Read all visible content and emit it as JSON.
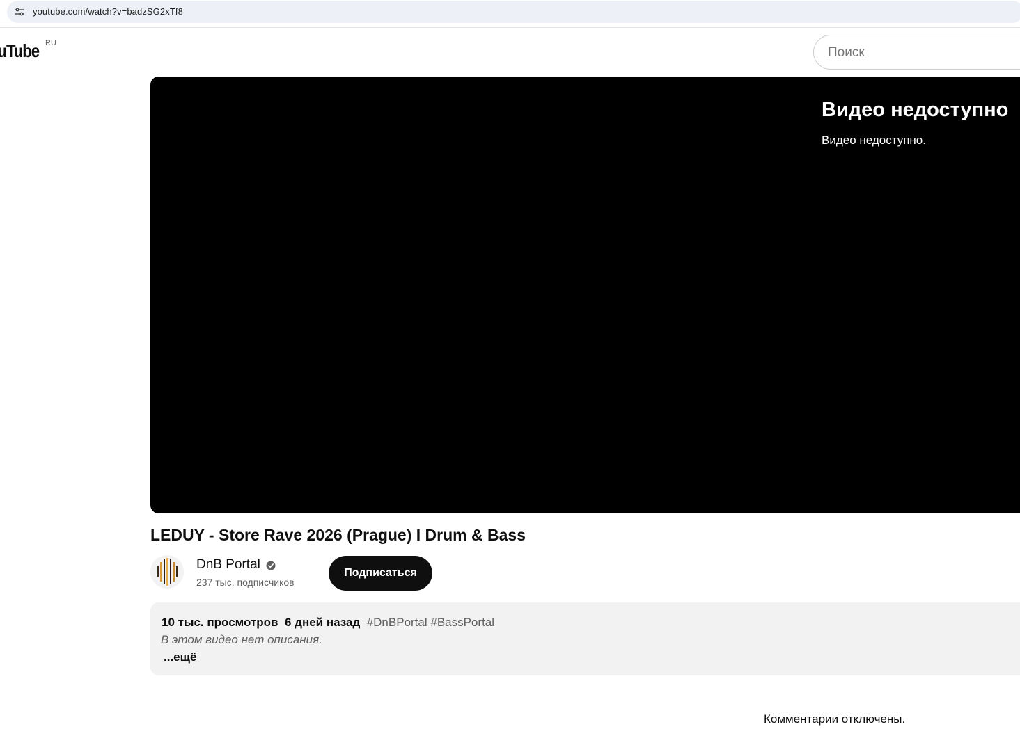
{
  "browser": {
    "url": "youtube.com/watch?v=badzSG2xTf8"
  },
  "header": {
    "logo_text": "ouTube",
    "country_code": "RU",
    "search_placeholder": "Поиск"
  },
  "player": {
    "error_title": "Видео недоступно",
    "error_message": "Видео недоступно."
  },
  "video": {
    "title": "LEDUY - Store Rave 2026 (Prague) I Drum & Bass"
  },
  "channel": {
    "name": "DnB Portal",
    "subscribers": "237 тыс. подписчиков",
    "subscribe_label": "Подписаться"
  },
  "description": {
    "views": "10 тыс. просмотров",
    "published": "6 дней назад",
    "hashtags": [
      "#DnBPortal",
      "#BassPortal"
    ],
    "empty_text": "В этом видео нет описания.",
    "more_label": "...ещё"
  },
  "comments": {
    "disabled_text": "Комментарии отключены."
  },
  "colors": {
    "text_primary": "#0f0f0f",
    "text_secondary": "#606060",
    "player_bg": "#000000",
    "subscribe_bg": "#0f0f0f",
    "description_bg": "#f2f2f2",
    "address_bar_bg": "#edf0f7"
  },
  "icons": {
    "site_info": "tune-icon",
    "verified": "verified-check-icon"
  }
}
